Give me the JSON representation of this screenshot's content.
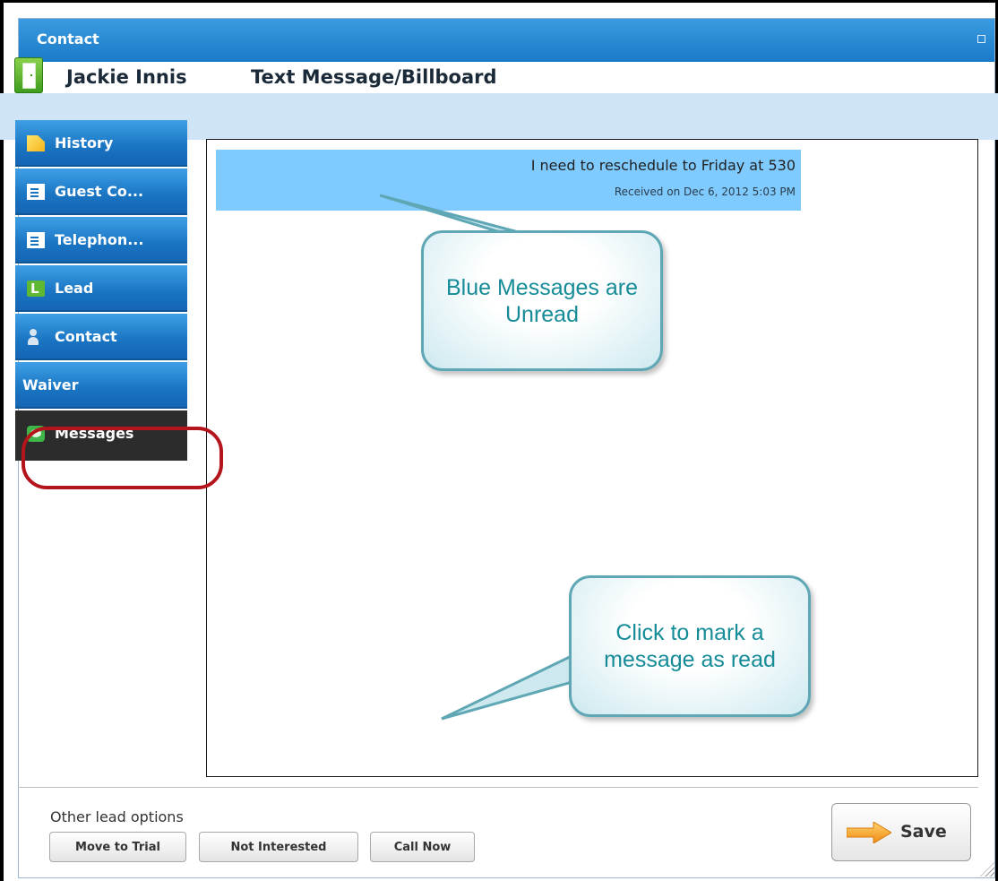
{
  "window": {
    "title": "Contact"
  },
  "header": {
    "contact_name": "Jackie Innis",
    "page_title": "Text Message/Billboard"
  },
  "sidebar": {
    "items": [
      {
        "label": "History",
        "icon": "history-icon"
      },
      {
        "label": "Guest Co...",
        "icon": "form-icon"
      },
      {
        "label": "Telephon...",
        "icon": "form-icon"
      },
      {
        "label": "Lead",
        "icon": "lead-icon"
      },
      {
        "label": "Contact",
        "icon": "person-icon"
      },
      {
        "label": "Waiver",
        "icon": ""
      },
      {
        "label": "Messages",
        "icon": "chat-icon",
        "active": true
      }
    ]
  },
  "messages": [
    {
      "text": "I need to reschedule to Friday at 530",
      "received": "Received on Dec 6, 2012 5:03 PM",
      "unread": true,
      "color": "#7fcaff"
    }
  ],
  "callouts": {
    "unread": "Blue Messages are Unread",
    "mark_read": "Click to mark a message as read"
  },
  "footer": {
    "other_options_label": "Other lead options",
    "buttons": {
      "move_to_trial": "Move to Trial",
      "not_interested": "Not Interested",
      "call_now": "Call Now"
    },
    "save_label": "Save"
  },
  "colors": {
    "titlebar": "#1a7ac8",
    "nav_active": "#2c2c2c",
    "highlight_oval": "#b4141b",
    "callout_text": "#168c98"
  }
}
